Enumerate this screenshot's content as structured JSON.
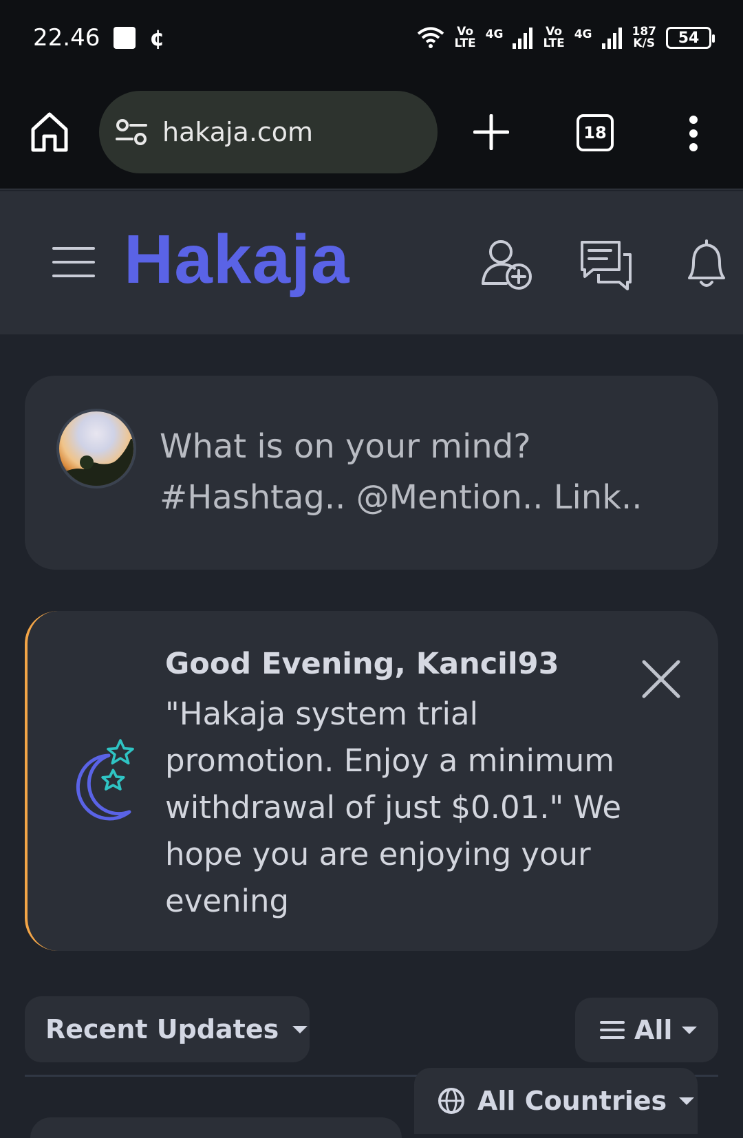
{
  "status_bar": {
    "time": "22.46",
    "net_speed_value": "187",
    "net_speed_unit": "K/S",
    "sim1_type": "4G",
    "sim2_type": "4G",
    "volte_top": "Vo",
    "volte_bottom": "LTE",
    "battery": "54"
  },
  "browser": {
    "url": "hakaja.com",
    "tab_count": "18"
  },
  "site": {
    "logo": "Hakaja"
  },
  "composer": {
    "placeholder": "What is on your mind? #Hashtag.. @Mention.. Link.."
  },
  "greeting": {
    "title": "Good Evening, Kancil93",
    "body": "\"Hakaja system trial promotion. Enjoy a minimum withdrawal of just $0.01.\" We hope you are enjoying your evening"
  },
  "filters": {
    "sort_label": "Recent Updates",
    "type_label": "All",
    "country_label": "All Countries"
  },
  "colors": {
    "brand": "#5a63e6",
    "accent_border": "#f3a547",
    "star": "#2fc4c4"
  }
}
